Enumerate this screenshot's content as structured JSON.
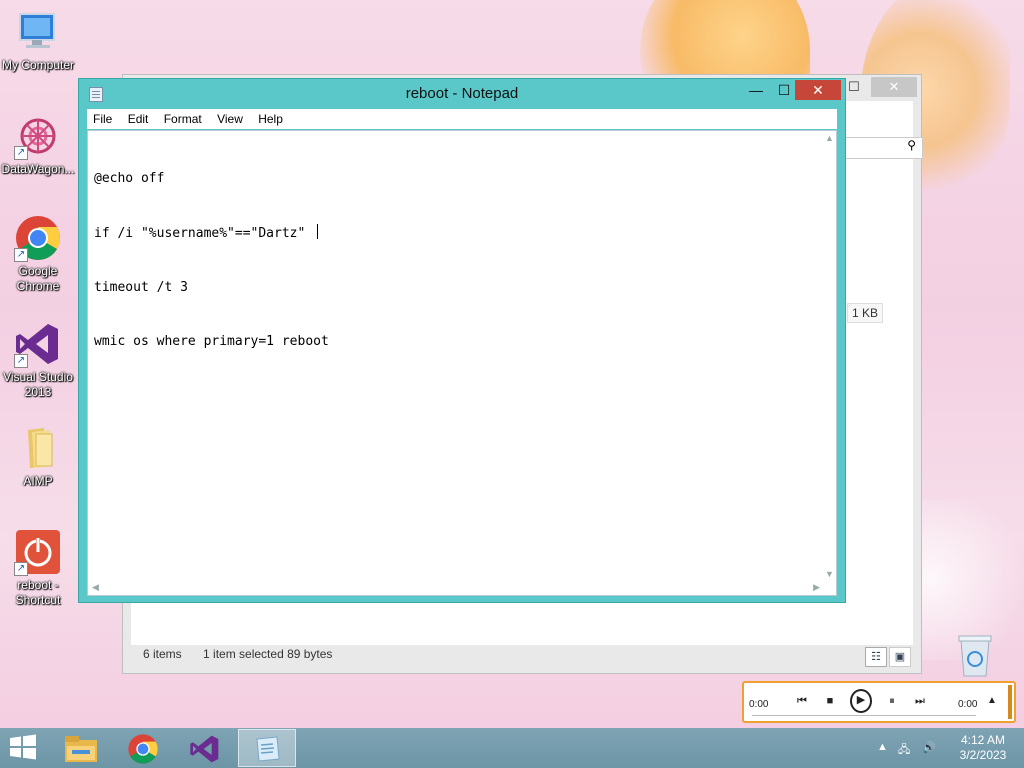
{
  "desktop": {
    "icons": [
      {
        "label": "My Computer"
      },
      {
        "label": "DataWagon..."
      },
      {
        "label": "Google Chrome"
      },
      {
        "label": "Visual Studio 2013"
      },
      {
        "label": "AIMP"
      },
      {
        "label": "reboot - Shortcut"
      }
    ]
  },
  "explorer": {
    "status_items": "6 items",
    "status_selected": "1 item selected  89 bytes",
    "file_size": "1 KB"
  },
  "notepad": {
    "title": "reboot - Notepad",
    "menu": [
      "File",
      "Edit",
      "Format",
      "View",
      "Help"
    ],
    "lines": [
      "@echo off",
      "if /i \"%username%\"==\"Dartz\" ",
      "timeout /t 3",
      "wmic os where primary=1 reboot"
    ]
  },
  "player": {
    "time_left": "0:00",
    "time_right": "0:00"
  },
  "taskbar": {
    "time": "4:12 AM",
    "date": "3/2/2023"
  },
  "colors": {
    "notepad_frame": "#5ac8c8",
    "close_button": "#c7463a",
    "taskbar": "#7096a7"
  }
}
